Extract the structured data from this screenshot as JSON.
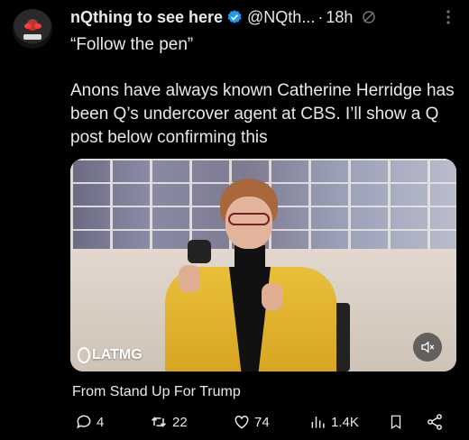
{
  "author": {
    "name": "nQthing to see here",
    "handle": "@NQth...",
    "time": "18h",
    "separator": "·"
  },
  "post": {
    "line1": "“Follow the pen”",
    "line2": "Anons have always known Catherine Herridge has been Q’s undercover agent at CBS. I’ll show a Q post below confirming this"
  },
  "media": {
    "watermark": "LATMG"
  },
  "source": "From Stand Up For Trump",
  "actions": {
    "replies": "4",
    "reposts": "22",
    "likes": "74",
    "views": "1.4K"
  },
  "colors": {
    "background": "#000000",
    "text": "#e7e9ea",
    "muted": "#71767b",
    "verified": "#1d9bf0"
  },
  "icons": [
    "verified-badge-icon",
    "grok-icon",
    "more-icon",
    "mute-icon",
    "reply-icon",
    "repost-icon",
    "like-icon",
    "views-icon",
    "bookmark-icon",
    "share-icon"
  ]
}
